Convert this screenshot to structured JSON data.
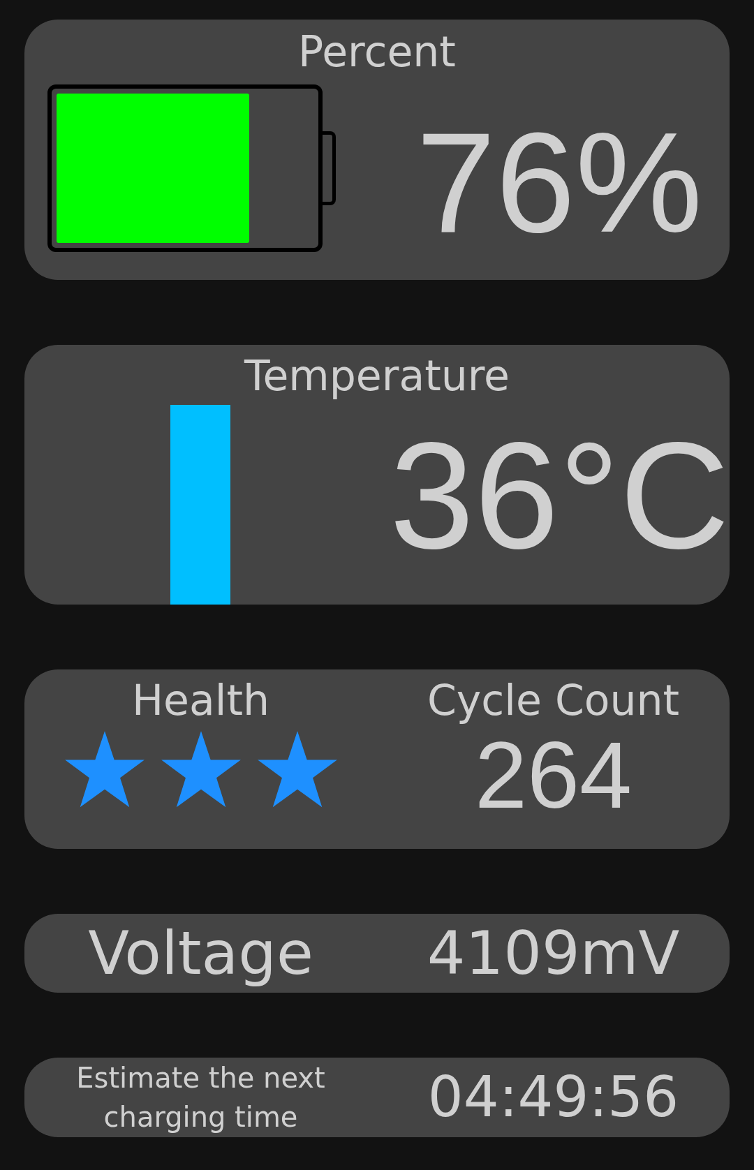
{
  "percent": {
    "title": "Percent",
    "value": "76%"
  },
  "temperature": {
    "title": "Temperature",
    "value": "36°C"
  },
  "health": {
    "title": "Health",
    "stars": 3
  },
  "cycle_count": {
    "title": "Cycle Count",
    "value": "264"
  },
  "voltage": {
    "label": "Voltage",
    "value": "4109mV"
  },
  "next_charge": {
    "label": "Estimate the next charging time",
    "value": "04:49:56"
  }
}
